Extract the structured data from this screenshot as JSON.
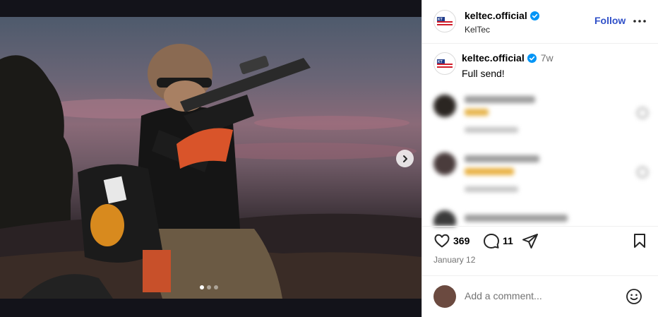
{
  "post": {
    "username": "keltec.official",
    "display_name": "KelTec",
    "follow_label": "Follow",
    "caption": "Full send!",
    "age": "7w",
    "likes": "369",
    "comments_count": "11",
    "date": "January 12",
    "add_comment_placeholder": "Add a comment...",
    "carousel": {
      "slides": 3,
      "active_slide": 1
    }
  },
  "colors": {
    "accent": "#3050c8",
    "verified": "#0095f6",
    "muted_text": "#737373"
  },
  "icons": [
    "verified-badge-icon",
    "more-options-icon",
    "chevron-right-icon",
    "heart-icon",
    "comment-icon",
    "share-icon",
    "bookmark-icon",
    "emoji-icon"
  ]
}
